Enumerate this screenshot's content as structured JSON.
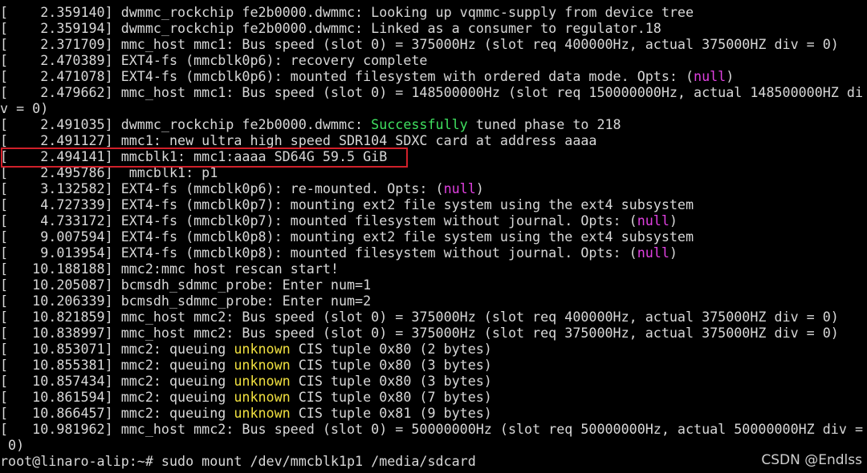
{
  "terminal": {
    "lines": [
      [
        {
          "text": "[    2.359140] dwmmc_rockchip fe2b0000.dwmmc: Looking up vqmmc-supply from device tree"
        }
      ],
      [
        {
          "text": "[    2.359194] dwmmc_rockchip fe2b0000.dwmmc: Linked as a consumer to regulator.18"
        }
      ],
      [
        {
          "text": "[    2.371709] mmc_host mmc1: Bus speed (slot 0) = 375000Hz (slot req 400000Hz, actual 375000HZ div = 0)"
        }
      ],
      [
        {
          "text": "[    2.470389] EXT4-fs (mmcblk0p6): recovery complete"
        }
      ],
      [
        {
          "text": "[    2.471078] EXT4-fs (mmcblk0p6): mounted filesystem with ordered data mode. Opts: ("
        },
        {
          "text": "null",
          "color": "magenta"
        },
        {
          "text": ")"
        }
      ],
      [
        {
          "text": "[    2.479662] mmc_host mmc1: Bus speed (slot 0) = 148500000Hz (slot req 150000000Hz, actual 148500000HZ di"
        }
      ],
      [
        {
          "text": "v = 0)"
        }
      ],
      [
        {
          "text": "[    2.491035] dwmmc_rockchip fe2b0000.dwmmc: "
        },
        {
          "text": "Successfully",
          "color": "green"
        },
        {
          "text": " tuned phase to 218"
        }
      ],
      [
        {
          "text": "[    2.491127] mmc1: new ultra high speed SDR104 SDXC card at address aaaa"
        }
      ],
      [
        {
          "text": "[    2.494141] mmcblk1: mmc1:aaaa SD64G 59.5 GiB"
        }
      ],
      [
        {
          "text": "[    2.495786]  mmcblk1: p1"
        }
      ],
      [
        {
          "text": "[    3.132582] EXT4-fs (mmcblk0p6): re-mounted. Opts: ("
        },
        {
          "text": "null",
          "color": "magenta"
        },
        {
          "text": ")"
        }
      ],
      [
        {
          "text": "[    4.727339] EXT4-fs (mmcblk0p7): mounting ext2 file system using the ext4 subsystem"
        }
      ],
      [
        {
          "text": "[    4.733172] EXT4-fs (mmcblk0p7): mounted filesystem without journal. Opts: ("
        },
        {
          "text": "null",
          "color": "magenta"
        },
        {
          "text": ")"
        }
      ],
      [
        {
          "text": "[    9.007594] EXT4-fs (mmcblk0p8): mounting ext2 file system using the ext4 subsystem"
        }
      ],
      [
        {
          "text": "[    9.013954] EXT4-fs (mmcblk0p8): mounted filesystem without journal. Opts: ("
        },
        {
          "text": "null",
          "color": "magenta"
        },
        {
          "text": ")"
        }
      ],
      [
        {
          "text": "[   10.188188] mmc2:mmc host rescan start!"
        }
      ],
      [
        {
          "text": "[   10.205087] bcmsdh_sdmmc_probe: Enter num=1"
        }
      ],
      [
        {
          "text": "[   10.206339] bcmsdh_sdmmc_probe: Enter num=2"
        }
      ],
      [
        {
          "text": "[   10.821859] mmc_host mmc2: Bus speed (slot 0) = 375000Hz (slot req 400000Hz, actual 375000HZ div = 0)"
        }
      ],
      [
        {
          "text": "[   10.838997] mmc_host mmc2: Bus speed (slot 0) = 375000Hz (slot req 375000Hz, actual 375000HZ div = 0)"
        }
      ],
      [
        {
          "text": "[   10.853071] mmc2: queuing "
        },
        {
          "text": "unknown",
          "color": "yellow"
        },
        {
          "text": " CIS tuple 0x80 (2 bytes)"
        }
      ],
      [
        {
          "text": "[   10.855381] mmc2: queuing "
        },
        {
          "text": "unknown",
          "color": "yellow"
        },
        {
          "text": " CIS tuple 0x80 (3 bytes)"
        }
      ],
      [
        {
          "text": "[   10.857434] mmc2: queuing "
        },
        {
          "text": "unknown",
          "color": "yellow"
        },
        {
          "text": " CIS tuple 0x80 (3 bytes)"
        }
      ],
      [
        {
          "text": "[   10.861594] mmc2: queuing "
        },
        {
          "text": "unknown",
          "color": "yellow"
        },
        {
          "text": " CIS tuple 0x80 (7 bytes)"
        }
      ],
      [
        {
          "text": "[   10.866457] mmc2: queuing "
        },
        {
          "text": "unknown",
          "color": "yellow"
        },
        {
          "text": " CIS tuple 0x81 (9 bytes)"
        }
      ],
      [
        {
          "text": "[   10.981962] mmc_host mmc2: Bus speed (slot 0) = 50000000Hz (slot req 50000000Hz, actual 50000000HZ div ="
        }
      ],
      [
        {
          "text": " 0)"
        }
      ],
      [
        {
          "text": "root@linaro-alip:~# sudo mount /dev/mmcblk1p1 /media/sdcard"
        }
      ]
    ],
    "highlighted_line_index": 9
  },
  "watermark": "CSDN @Endlss",
  "colors": {
    "background": "#000000",
    "text": "#d8d8d8",
    "magenta": "#e040e0",
    "green": "#40e060",
    "yellow": "#f0e040",
    "highlight_box": "#d0202a"
  }
}
